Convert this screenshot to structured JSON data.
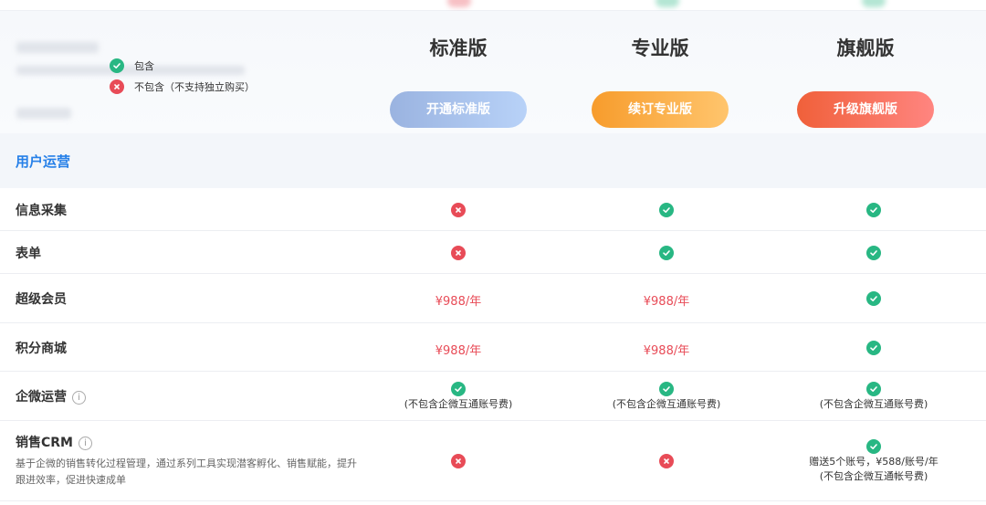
{
  "legend": {
    "included": "包含",
    "excluded": "不包含（不支持独立购买）"
  },
  "plans": [
    {
      "name": "标准版",
      "button": "开通标准版",
      "gradient": [
        "#9ab3e0",
        "#b8d2f8"
      ]
    },
    {
      "name": "专业版",
      "button": "续订专业版",
      "gradient": [
        "#f79c2c",
        "#ffc56d"
      ]
    },
    {
      "name": "旗舰版",
      "button": "升级旗舰版",
      "gradient": [
        "#f0603a",
        "#ff8580"
      ]
    }
  ],
  "section": {
    "title": "用户运营"
  },
  "rows": [
    {
      "feature": "信息采集",
      "cells": [
        {
          "status": "no"
        },
        {
          "status": "ok"
        },
        {
          "status": "ok"
        }
      ]
    },
    {
      "feature": "表单",
      "cells": [
        {
          "status": "no"
        },
        {
          "status": "ok"
        },
        {
          "status": "ok"
        }
      ]
    },
    {
      "feature": "超级会员",
      "cells": [
        {
          "price": "¥988/年"
        },
        {
          "price": "¥988/年"
        },
        {
          "status": "ok"
        }
      ]
    },
    {
      "feature": "积分商城",
      "cells": [
        {
          "price": "¥988/年"
        },
        {
          "price": "¥988/年"
        },
        {
          "status": "ok"
        }
      ]
    },
    {
      "feature": "企微运营",
      "info": "i",
      "cells": [
        {
          "status": "ok",
          "note": "(不包含企微互通账号费)"
        },
        {
          "status": "ok",
          "note": "(不包含企微互通账号费)"
        },
        {
          "status": "ok",
          "note": "(不包含企微互通账号费)"
        }
      ]
    },
    {
      "feature": "销售CRM",
      "info": "i",
      "description": "基于企微的销售转化过程管理，通过系列工具实现潜客孵化、销售赋能，提升跟进效率，促进快速成单",
      "cells": [
        {
          "status": "no"
        },
        {
          "status": "no"
        },
        {
          "status": "ok",
          "note": "赠送5个账号，¥588/账号/年",
          "note2": "(不包含企微互通帐号费)"
        }
      ]
    }
  ],
  "colors": {
    "ok": "#28b783",
    "no": "#e84b57",
    "accent": "#2680e8"
  },
  "icons": {
    "ok": "check-circle-icon",
    "no": "cross-circle-icon",
    "info": "info-circle-icon"
  }
}
